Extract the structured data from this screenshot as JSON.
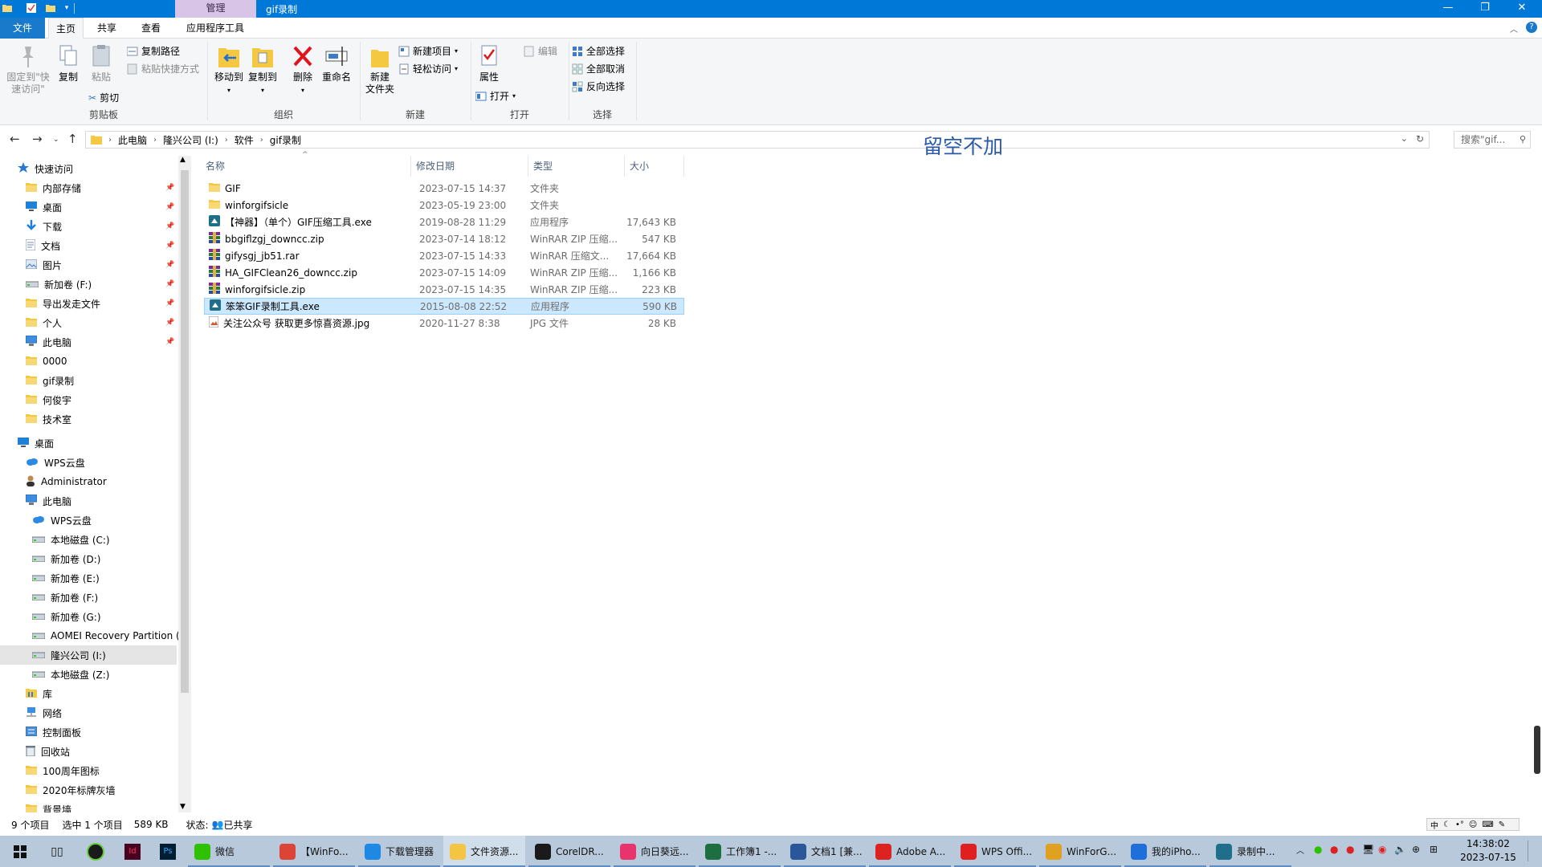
{
  "window": {
    "title": "gif录制",
    "context_tab": "管理",
    "tabs": [
      "文件",
      "主页",
      "共享",
      "查看",
      "应用程序工具"
    ],
    "active_tab": "主页"
  },
  "ribbon": {
    "clipboard": {
      "pin_label_1": "固定到\"快",
      "pin_label_2": "速访问\"",
      "copy": "复制",
      "paste": "粘贴",
      "copy_path": "复制路径",
      "paste_shortcut": "粘贴快捷方式",
      "cut": "剪切",
      "group": "剪贴板"
    },
    "organize": {
      "move_to": "移动到",
      "copy_to": "复制到",
      "delete": "删除",
      "rename": "重命名",
      "group": "组织"
    },
    "new": {
      "new_folder_1": "新建",
      "new_folder_2": "文件夹",
      "new_item": "新建项目",
      "easy_access": "轻松访问",
      "group": "新建"
    },
    "open": {
      "properties": "属性",
      "open": "打开",
      "edit": "编辑",
      "group": "打开"
    },
    "select": {
      "select_all": "全部选择",
      "select_none": "全部取消",
      "invert": "反向选择",
      "group": "选择"
    }
  },
  "address": {
    "crumbs": [
      "此电脑",
      "隆兴公司 (I:)",
      "软件",
      "gif录制"
    ],
    "overlay_text": "留空不加",
    "search_placeholder": "搜索\"gif..."
  },
  "sidebar": {
    "items": [
      {
        "label": "快速访问",
        "icon": "star-icon",
        "level": 0,
        "pinned": false
      },
      {
        "label": "内部存储",
        "icon": "folder-icon",
        "level": 1,
        "pinned": true
      },
      {
        "label": "桌面",
        "icon": "desktop-icon",
        "level": 1,
        "pinned": true
      },
      {
        "label": "下载",
        "icon": "download-icon",
        "level": 1,
        "pinned": true
      },
      {
        "label": "文档",
        "icon": "document-icon",
        "level": 1,
        "pinned": true
      },
      {
        "label": "图片",
        "icon": "picture-icon",
        "level": 1,
        "pinned": true
      },
      {
        "label": "新加卷 (F:)",
        "icon": "drive-icon",
        "level": 1,
        "pinned": true
      },
      {
        "label": "导出发走文件",
        "icon": "folder-icon",
        "level": 1,
        "pinned": true
      },
      {
        "label": "个人",
        "icon": "folder-icon",
        "level": 1,
        "pinned": true
      },
      {
        "label": "此电脑",
        "icon": "computer-icon",
        "level": 1,
        "pinned": true
      },
      {
        "label": "0000",
        "icon": "folder-icon",
        "level": 1,
        "pinned": false
      },
      {
        "label": "gif录制",
        "icon": "folder-icon",
        "level": 1,
        "pinned": false
      },
      {
        "label": "何俊宇",
        "icon": "folder-icon",
        "level": 1,
        "pinned": false
      },
      {
        "label": "技术室",
        "icon": "folder-icon",
        "level": 1,
        "pinned": false
      },
      {
        "label": "桌面",
        "icon": "desktop-icon",
        "level": 0,
        "pinned": false
      },
      {
        "label": "WPS云盘",
        "icon": "cloud-icon",
        "level": 1,
        "pinned": false
      },
      {
        "label": "Administrator",
        "icon": "user-icon",
        "level": 1,
        "pinned": false
      },
      {
        "label": "此电脑",
        "icon": "computer-icon",
        "level": 1,
        "pinned": false
      },
      {
        "label": "WPS云盘",
        "icon": "cloud-icon",
        "level": 2,
        "pinned": false
      },
      {
        "label": "本地磁盘 (C:)",
        "icon": "drive-icon",
        "level": 2,
        "pinned": false
      },
      {
        "label": "新加卷 (D:)",
        "icon": "drive-icon",
        "level": 2,
        "pinned": false
      },
      {
        "label": "新加卷 (E:)",
        "icon": "drive-icon",
        "level": 2,
        "pinned": false
      },
      {
        "label": "新加卷 (F:)",
        "icon": "drive-icon",
        "level": 2,
        "pinned": false
      },
      {
        "label": "新加卷 (G:)",
        "icon": "drive-icon",
        "level": 2,
        "pinned": false
      },
      {
        "label": "AOMEI Recovery Partition (",
        "icon": "drive-icon",
        "level": 2,
        "pinned": false
      },
      {
        "label": "隆兴公司 (I:)",
        "icon": "drive-icon",
        "level": 2,
        "pinned": false,
        "selected": true
      },
      {
        "label": "本地磁盘 (Z:)",
        "icon": "drive-icon",
        "level": 2,
        "pinned": false
      },
      {
        "label": "库",
        "icon": "library-icon",
        "level": 1,
        "pinned": false
      },
      {
        "label": "网络",
        "icon": "network-icon",
        "level": 1,
        "pinned": false
      },
      {
        "label": "控制面板",
        "icon": "control-panel-icon",
        "level": 1,
        "pinned": false
      },
      {
        "label": "回收站",
        "icon": "recycle-bin-icon",
        "level": 1,
        "pinned": false
      },
      {
        "label": "100周年图标",
        "icon": "folder-icon",
        "level": 1,
        "pinned": false
      },
      {
        "label": "2020年标牌灰墙",
        "icon": "folder-icon",
        "level": 1,
        "pinned": false
      },
      {
        "label": "背景墙",
        "icon": "folder-icon",
        "level": 1,
        "pinned": false
      }
    ]
  },
  "files": {
    "columns": [
      "名称",
      "修改日期",
      "类型",
      "大小"
    ],
    "rows": [
      {
        "name": "GIF",
        "date": "2023-07-15 14:37",
        "type": "文件夹",
        "size": "",
        "icon": "folder-icon"
      },
      {
        "name": "winforgifsicle",
        "date": "2023-05-19 23:00",
        "type": "文件夹",
        "size": "",
        "icon": "folder-icon"
      },
      {
        "name": "【神器】（单个）GIF压缩工具.exe",
        "date": "2019-08-28 11:29",
        "type": "应用程序",
        "size": "17,643 KB",
        "icon": "app-icon"
      },
      {
        "name": "bbgiflzgj_downcc.zip",
        "date": "2023-07-14 18:12",
        "type": "WinRAR ZIP 压缩...",
        "size": "547 KB",
        "icon": "winrar-icon"
      },
      {
        "name": "gifysgj_jb51.rar",
        "date": "2023-07-15 14:33",
        "type": "WinRAR 压缩文...",
        "size": "17,664 KB",
        "icon": "winrar-icon"
      },
      {
        "name": "HA_GIFClean26_downcc.zip",
        "date": "2023-07-15 14:09",
        "type": "WinRAR ZIP 压缩...",
        "size": "1,166 KB",
        "icon": "winrar-icon"
      },
      {
        "name": "winforgifsicle.zip",
        "date": "2023-07-15 14:35",
        "type": "WinRAR ZIP 压缩...",
        "size": "223 KB",
        "icon": "winrar-icon"
      },
      {
        "name": "笨笨GIF录制工具.exe",
        "date": "2015-08-08 22:52",
        "type": "应用程序",
        "size": "590 KB",
        "icon": "app-icon",
        "selected": true
      },
      {
        "name": "关注公众号 获取更多惊喜资源.jpg",
        "date": "2020-11-27 8:38",
        "type": "JPG 文件",
        "size": "28 KB",
        "icon": "image-file-icon"
      }
    ]
  },
  "status": {
    "count": "9 个项目",
    "selected": "选中 1 个项目",
    "size": "589 KB",
    "state_label": "状态:",
    "state_value": "已共享"
  },
  "taskbar": {
    "apps": [
      {
        "label": "微信",
        "icon": "wechat-icon",
        "color": "#2dc100"
      },
      {
        "label": "【WinFo...",
        "icon": "chrome-icon",
        "color": "#db4437"
      },
      {
        "label": "下载管理器",
        "icon": "download-manager-icon",
        "color": "#1e88e5"
      },
      {
        "label": "文件资源...",
        "icon": "explorer-icon",
        "color": "#f4c542",
        "active": true
      },
      {
        "label": "CorelDR...",
        "icon": "coreldraw-icon",
        "color": "#1a1a1a"
      },
      {
        "label": "向日葵远...",
        "icon": "sunflower-icon",
        "color": "#e8336d"
      },
      {
        "label": "工作簿1 -...",
        "icon": "excel-icon",
        "color": "#1d6f42"
      },
      {
        "label": "文档1 [兼...",
        "icon": "word-icon",
        "color": "#2b579a"
      },
      {
        "label": "Adobe A...",
        "icon": "acrobat-icon",
        "color": "#d22"
      },
      {
        "label": "WPS Offi...",
        "icon": "wps-icon",
        "color": "#e02020"
      },
      {
        "label": "WinForG...",
        "icon": "winforgif-icon",
        "color": "#e0a020"
      },
      {
        "label": "我的iPho...",
        "icon": "phone-icon",
        "color": "#1e6fd9"
      },
      {
        "label": "录制中...",
        "icon": "gif-recorder-icon",
        "color": "#1f6f8b"
      }
    ],
    "time": "14:38:02",
    "date": "2023-07-15",
    "ime_label": "中"
  },
  "colors": {
    "titlebar": "#0078d7",
    "context_tab": "#d8c4e6",
    "selection": "#cce8ff",
    "taskbar": "#b8c9dc"
  }
}
